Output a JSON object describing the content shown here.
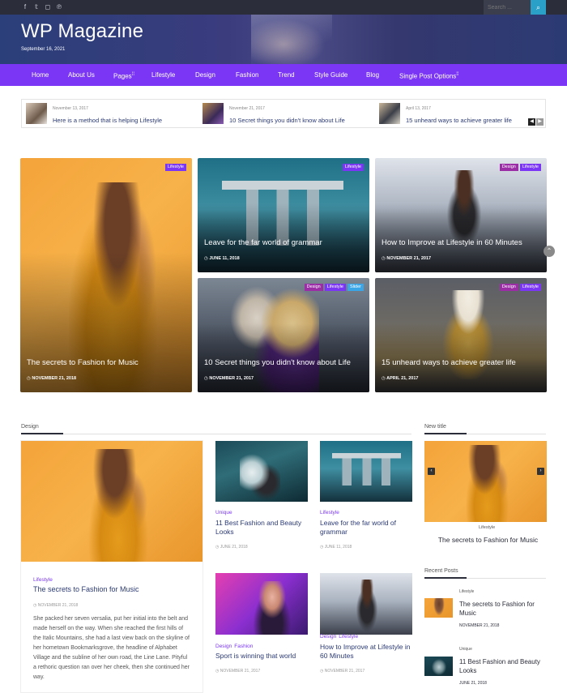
{
  "topbar": {
    "social": [
      "f",
      "𝕥",
      "◻",
      "℗"
    ],
    "search_placeholder": "Search ...",
    "search_icon": "search-icon",
    "search_glyph": "⌕"
  },
  "header": {
    "title": "WP Magazine",
    "date": "September 16, 2021"
  },
  "nav": {
    "items": [
      "Home",
      "About Us",
      "Pages",
      "Lifestyle",
      "Design",
      "Fashion",
      "Trend",
      "Style Guide",
      "Blog",
      "Single Post Options"
    ],
    "dropdown_marker": "⁞⁞"
  },
  "ticker": {
    "items": [
      {
        "date": "November 13, 2017",
        "title": "Here is a method that is helping Lifestyle"
      },
      {
        "date": "November 21, 2017",
        "title": "10 Secret things you didn't know about Life"
      },
      {
        "date": "April 13, 2017",
        "title": "15 unheard ways to achieve greater life"
      }
    ],
    "prev": "◀",
    "next": "▶"
  },
  "featured": [
    {
      "title": "The secrets to Fashion for Music",
      "date": "NOVEMBER 21, 2018",
      "badges": [
        "Lifestyle"
      ]
    },
    {
      "title": "Leave for the far world of grammar",
      "date": "JUNE 11, 2018",
      "badges": [
        "Lifestyle"
      ]
    },
    {
      "title": "How to Improve at Lifestyle in 60 Minutes",
      "date": "NOVEMBER 21, 2017",
      "badges": [
        "Design",
        "Lifestyle"
      ]
    },
    {
      "title": "10 Secret things you didn't know about Life",
      "date": "NOVEMBER 21, 2017",
      "badges": [
        "Design",
        "Lifestyle",
        "Slider"
      ]
    },
    {
      "title": "15 unheard ways to achieve greater life",
      "date": "APRIL 21, 2017",
      "badges": [
        "Design",
        "Lifestyle"
      ]
    }
  ],
  "clock_glyph": "◷",
  "scroll_top": "⌃",
  "design_section": {
    "heading": "Design",
    "main": {
      "category": "Lifestyle",
      "title": "The secrets to Fashion for Music",
      "date": "NOVEMBER 21, 2018",
      "excerpt": "She packed her seven versalia, put her initial into the belt and made herself on the way. When she reached the first hills of the Italic Mountains, she had a last view back on the skyline of her hometown Bookmarksgrove, the headline of Alphabet Village and the subline of her own road, the Line Lane. Pityful a rethoric question ran over her cheek, then she continued her way."
    },
    "posts": [
      {
        "categories": [
          "Unique"
        ],
        "title": "11 Best Fashion and Beauty Looks",
        "date": "JUNE 21, 2018"
      },
      {
        "categories": [
          "Lifestyle"
        ],
        "title": "Leave for the far world of grammar",
        "date": "JUNE 11, 2018"
      },
      {
        "categories": [
          "Design",
          "Fashion"
        ],
        "title": "Sport is winning that world",
        "date": "NOVEMBER 21, 2017"
      },
      {
        "categories": [
          "Design",
          "Lifestyle"
        ],
        "title": "How to Improve at Lifestyle in 60 Minutes",
        "date": "NOVEMBER 21, 2017"
      }
    ]
  },
  "sidebar": {
    "new_title_heading": "New title",
    "slider": {
      "category": "Lifestyle",
      "title": "The secrets to Fashion for Music",
      "prev": "‹",
      "next": "›"
    },
    "recent_heading": "Recent Posts",
    "recent": [
      {
        "category": "Lifestyle",
        "title": "The secrets to Fashion for Music",
        "date": "NOVEMBER 21, 2018"
      },
      {
        "category": "Unique",
        "title": "11 Best Fashion and Beauty Looks",
        "date": "JUNE 21, 2018"
      }
    ]
  },
  "colors": {
    "accent": "#7b36f5",
    "topbar": "#2b2d3a",
    "search_button": "#2aa0c9",
    "link": "#2b3a75"
  }
}
